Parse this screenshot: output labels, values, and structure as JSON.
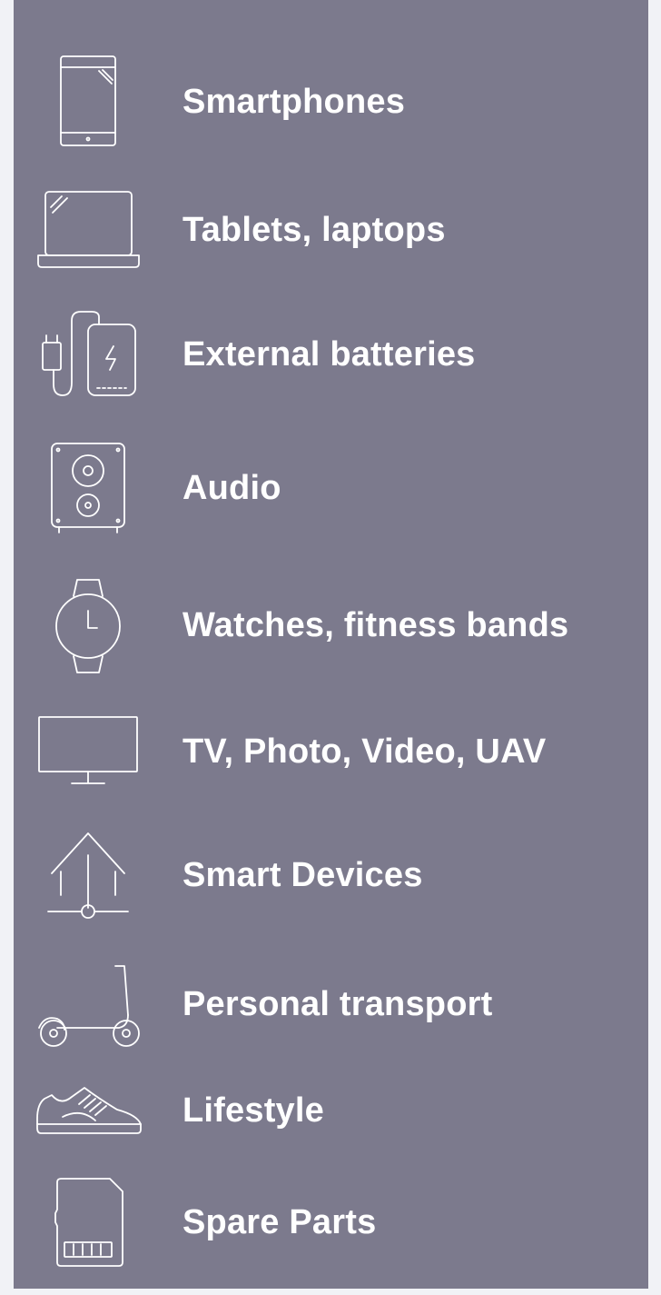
{
  "menu": {
    "items": [
      {
        "label": "Smartphones",
        "icon": "smartphone-icon"
      },
      {
        "label": "Tablets, laptops",
        "icon": "laptop-icon"
      },
      {
        "label": "External batteries",
        "icon": "power-bank-icon"
      },
      {
        "label": "Audio",
        "icon": "speaker-icon"
      },
      {
        "label": "Watches, fitness bands",
        "icon": "watch-icon"
      },
      {
        "label": "TV, Photo, Video, UAV",
        "icon": "tv-icon"
      },
      {
        "label": "Smart Devices",
        "icon": "smart-home-icon"
      },
      {
        "label": "Personal transport",
        "icon": "scooter-icon"
      },
      {
        "label": "Lifestyle",
        "icon": "sneaker-icon"
      },
      {
        "label": "Spare Parts",
        "icon": "sd-card-icon"
      }
    ]
  },
  "colors": {
    "menu_background": "#7c7a8d",
    "page_background": "#f1f2f6",
    "text": "#ffffff"
  }
}
